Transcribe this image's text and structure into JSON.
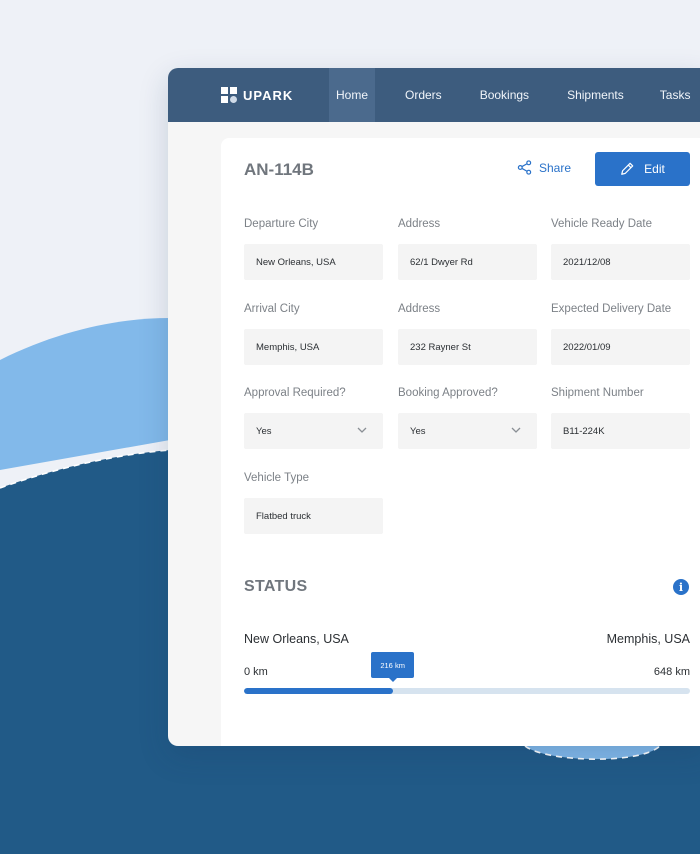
{
  "app": {
    "logo_text": "UPARK"
  },
  "nav": [
    {
      "label": "Home",
      "active": true
    },
    {
      "label": "Orders",
      "active": false
    },
    {
      "label": "Bookings",
      "active": false
    },
    {
      "label": "Shipments",
      "active": false
    },
    {
      "label": "Tasks",
      "active": false
    }
  ],
  "record": {
    "id": "AN-114B",
    "share_label": "Share",
    "edit_label": "Edit"
  },
  "fields": {
    "departure_city": {
      "label": "Departure City",
      "value": "New Orleans, USA"
    },
    "departure_address": {
      "label": "Address",
      "value": "62/1 Dwyer Rd"
    },
    "vehicle_ready_date": {
      "label": "Vehicle Ready Date",
      "value": "2021/12/08"
    },
    "arrival_city": {
      "label": "Arrival City",
      "value": "Memphis, USA"
    },
    "arrival_address": {
      "label": "Address",
      "value": "232 Rayner St"
    },
    "expected_delivery_date": {
      "label": "Expected Delivery Date",
      "value": "2022/01/09"
    },
    "approval_required": {
      "label": "Approval Required?",
      "value": "Yes"
    },
    "booking_approved": {
      "label": "Booking Approved?",
      "value": "Yes"
    },
    "shipment_number": {
      "label": "Shipment Number",
      "value": "B11-224K"
    },
    "vehicle_type": {
      "label": "Vehicle Type",
      "value": "Flatbed truck"
    }
  },
  "status": {
    "title": "STATUS",
    "from_city": "New Orleans, USA",
    "to_city": "Memphis, USA",
    "start_label": "0 km",
    "end_label": "648 km",
    "current_label": "216 km",
    "current_km": 216,
    "total_km": 648
  },
  "colors": {
    "accent": "#2a72c9",
    "topbar": "#3d5c7e",
    "wave_light": "#82b9ea",
    "wave_dark": "#215a87"
  },
  "icons": {
    "share": "share-icon",
    "edit": "pencil-icon",
    "chevron": "chevron-down-icon",
    "info": "info-icon"
  }
}
